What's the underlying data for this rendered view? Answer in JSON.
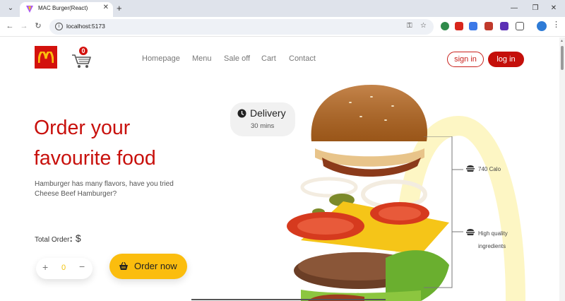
{
  "browser": {
    "tab_title": "MAC Burger(React)",
    "url": "localhost:5173",
    "icons": [
      "tab-dropdown-icon",
      "close-icon",
      "plus-icon",
      "minimize-icon",
      "restore-icon",
      "window-close-icon",
      "back-icon",
      "forward-icon",
      "reload-icon",
      "info-icon",
      "key-icon",
      "star-icon",
      "extension-icon",
      "profile-icon",
      "kebab-icon"
    ]
  },
  "header": {
    "cart_count": "0",
    "nav": [
      "Homepage",
      "Menu",
      "Sale off",
      "Cart",
      "Contact"
    ],
    "sign_in": "sign in",
    "log_in": "log in"
  },
  "hero": {
    "title_line1": "Order your",
    "title_line2": "favourite food",
    "subtitle": "Hamburger has many flavors, have you tried Cheese Beef Hamburger?",
    "total_label": "Total Order",
    "total_colon": ":",
    "currency": "$",
    "qty_plus": "+",
    "qty_value": "0",
    "qty_minus": "−",
    "order_button": "Order now"
  },
  "delivery": {
    "title": "Delivery",
    "time": "30 mins"
  },
  "features": {
    "calories": "740 Calo",
    "quality_line1": "High quality",
    "quality_line2": "ingredients"
  },
  "colors": {
    "brand_red": "#c8100c",
    "accent_yellow": "#fbbd0e"
  }
}
